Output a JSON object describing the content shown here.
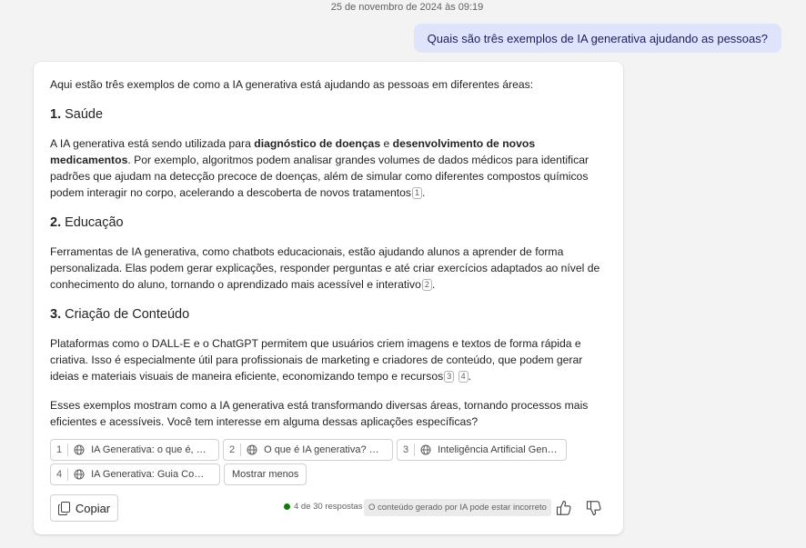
{
  "timestamp": "25 de novembro de 2024 às 09:19",
  "user_message": "Quais são três exemplos de IA generativa ajudando as pessoas?",
  "response": {
    "intro": "Aqui estão três exemplos de como a IA generativa está ajudando as pessoas em diferentes áreas:",
    "sections": [
      {
        "number": "1.",
        "heading": "Saúde",
        "text_1": "A IA generativa está sendo utilizada para ",
        "bold_1": "diagnóstico de doenças",
        "text_2": " e ",
        "bold_2": "desenvolvimento de novos medicamentos",
        "text_3": ". Por exemplo, algoritmos podem analisar grandes volumes de dados médicos para identificar padrões que ajudam na detecção precoce de doenças, além de simular como diferentes compostos químicos podem interagir no corpo, acelerando a descoberta de novos tratamentos",
        "citations": [
          "1"
        ]
      },
      {
        "number": "2.",
        "heading": "Educação",
        "text": "Ferramentas de IA generativa, como chatbots educacionais, estão ajudando alunos a aprender de forma personalizada. Elas podem gerar explicações, responder perguntas e até criar exercícios adaptados ao nível de conhecimento do aluno, tornando o aprendizado mais acessível e interativo",
        "citations": [
          "2"
        ]
      },
      {
        "number": "3.",
        "heading": "Criação de Conteúdo",
        "text": "Plataformas como o DALL-E e o ChatGPT permitem que usuários criem imagens e textos de forma rápida e criativa. Isso é especialmente útil para profissionais de marketing e criadores de conteúdo, que podem gerar ideias e materiais visuais de maneira eficiente, economizando tempo e recursos",
        "citations": [
          "3",
          "4"
        ]
      }
    ],
    "conclusion": "Esses exemplos mostram como a IA generativa está transformando diversas áreas, tornando processos mais eficientes e acessíveis. Você tem interesse em alguma dessas aplicações específicas?",
    "period": "."
  },
  "references": [
    {
      "number": "1",
      "title": "IA Generativa: o que é, co..."
    },
    {
      "number": "2",
      "title": "O que é IA generativa? Vej..."
    },
    {
      "number": "3",
      "title": "Inteligência Artificial Gene..."
    },
    {
      "number": "4",
      "title": "IA Generativa: Guia Compl..."
    }
  ],
  "show_less_label": "Mostrar menos",
  "footer": {
    "copy_label": "Copiar",
    "response_count": "4 de 30 respostas",
    "disclaimer": "O conteúdo gerado por IA pode estar incorreto"
  },
  "colors": {
    "background": "#f3f3f3",
    "user_bubble": "#e0e4fb",
    "status_dot": "#107c10"
  },
  "icons": [
    "globe-icon",
    "copy-icon",
    "thumbs-up-icon",
    "thumbs-down-icon"
  ]
}
